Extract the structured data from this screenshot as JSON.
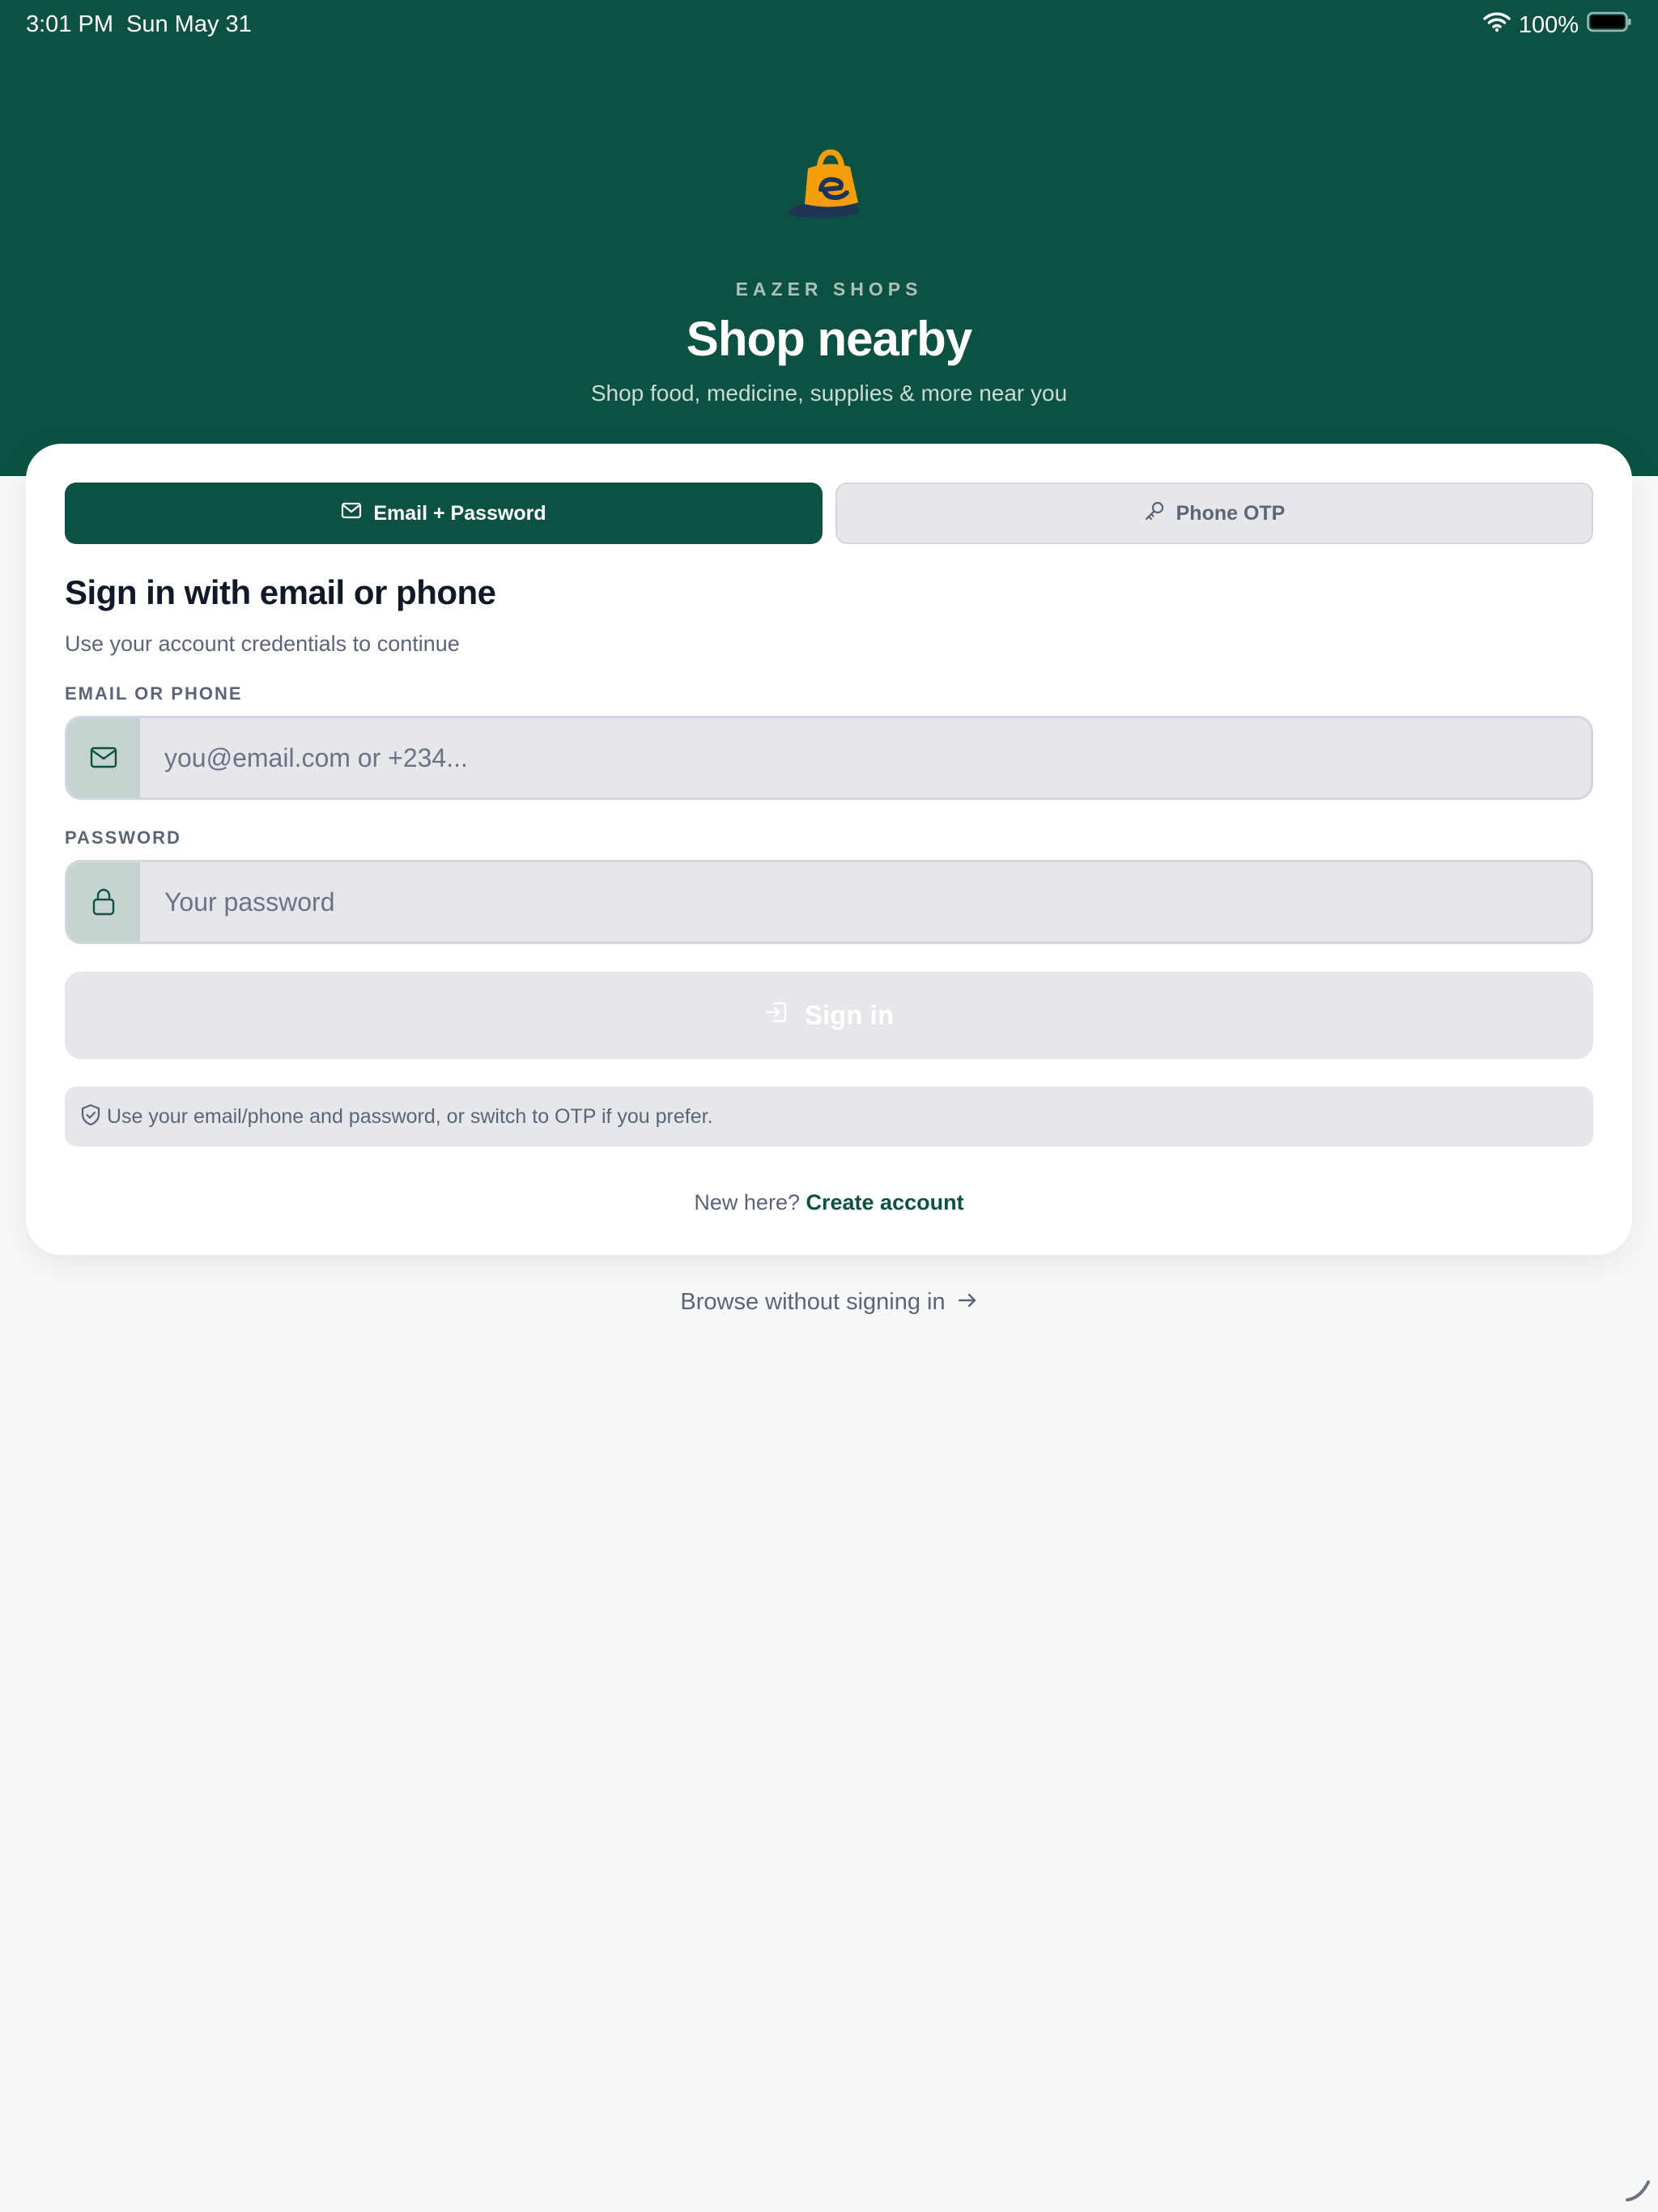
{
  "status_bar": {
    "time": "3:01 PM",
    "date": "Sun May 31",
    "battery": "100%"
  },
  "header": {
    "brand": "EAZER SHOPS",
    "title": "Shop nearby",
    "subtitle": "Shop food, medicine, supplies & more near you"
  },
  "tabs": {
    "email_label": "Email + Password",
    "phone_label": "Phone OTP"
  },
  "form": {
    "heading": "Sign in with email or phone",
    "description": "Use your account credentials to continue",
    "email_label": "EMAIL OR PHONE",
    "email_placeholder": "you@email.com or +234...",
    "password_label": "PASSWORD",
    "password_placeholder": "Your password",
    "signin_label": "Sign in",
    "hint": "Use your email/phone and password, or switch to OTP if you prefer.",
    "new_here": "New here?",
    "create_account": "Create account"
  },
  "browse": {
    "label": "Browse without signing in"
  },
  "colors": {
    "brand_green": "#0c5141",
    "accent_orange": "#f59e0b",
    "muted_text": "#5b6577"
  },
  "icons": {
    "wifi": "wifi-icon",
    "battery": "battery-icon",
    "mail": "mail-icon",
    "key": "key-icon",
    "lock": "lock-icon",
    "login": "login-icon",
    "shield": "shield-check-icon",
    "arrow": "arrow-right-icon"
  }
}
